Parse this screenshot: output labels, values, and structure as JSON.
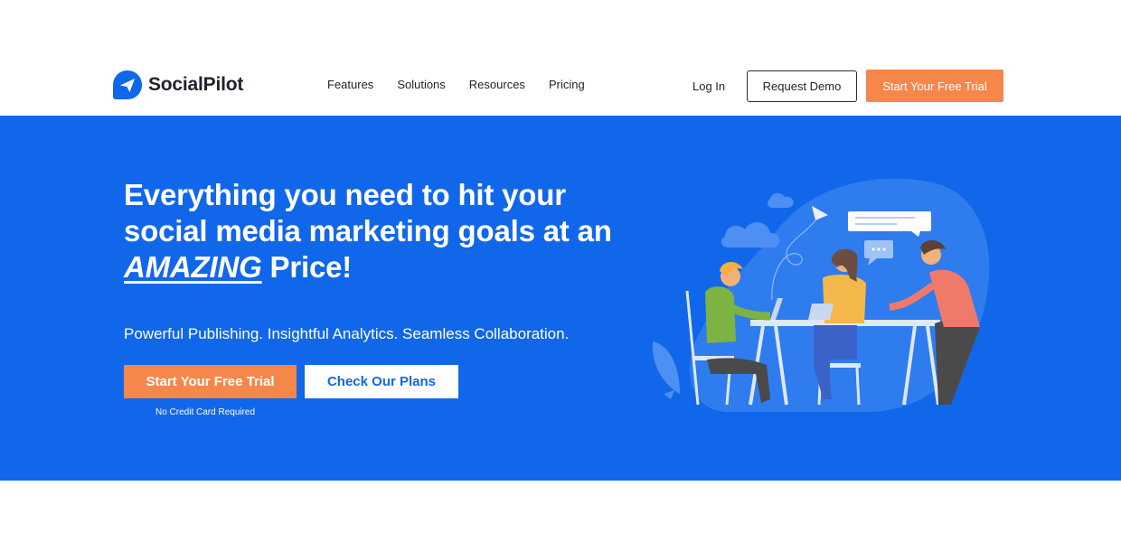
{
  "brand": {
    "name": "SocialPilot",
    "icon": "paper-plane-icon",
    "color": "#1167ea"
  },
  "nav": {
    "items": [
      {
        "label": "Features"
      },
      {
        "label": "Solutions"
      },
      {
        "label": "Resources"
      },
      {
        "label": "Pricing"
      }
    ],
    "login_label": "Log In",
    "demo_label": "Request Demo",
    "trial_label": "Start Your Free Trial"
  },
  "hero": {
    "headline_line1": "Everything you need to hit your",
    "headline_line2": "social media marketing goals at an",
    "headline_emphasis": "AMAZING",
    "headline_end": " Price!",
    "subline": "Powerful Publishing. Insightful Analytics. Seamless Collaboration.",
    "cta_primary": "Start Your Free Trial",
    "cta_secondary": "Check Our Plans",
    "note": "No Credit Card Required",
    "illustration": "team-collaboration-illustration"
  },
  "colors": {
    "hero_bg": "#1167ea",
    "accent": "#f6874b",
    "text_dark": "#1e2128"
  }
}
